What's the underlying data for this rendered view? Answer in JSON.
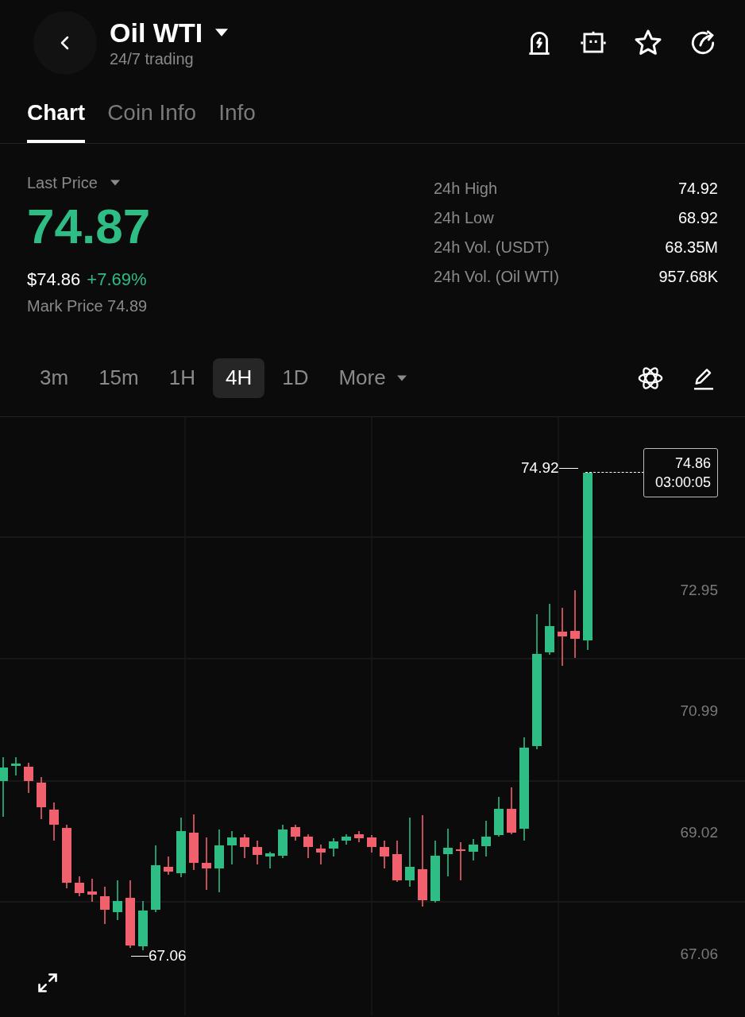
{
  "header": {
    "title": "Oil WTI",
    "subtitle": "24/7 trading"
  },
  "tabs": [
    {
      "label": "Chart",
      "selected": true
    },
    {
      "label": "Coin Info",
      "selected": false
    },
    {
      "label": "Info",
      "selected": false
    }
  ],
  "price": {
    "label": "Last Price",
    "value": "74.87",
    "usd": "$74.86",
    "change": "+7.69%",
    "mark_price": "Mark Price 74.89"
  },
  "stats": [
    {
      "label": "24h High",
      "value": "74.92"
    },
    {
      "label": "24h Low",
      "value": "68.92"
    },
    {
      "label": "24h Vol. (USDT)",
      "value": "68.35M"
    },
    {
      "label": "24h Vol. (Oil WTI)",
      "value": "957.68K"
    }
  ],
  "intervals": [
    {
      "label": "3m",
      "selected": false
    },
    {
      "label": "15m",
      "selected": false
    },
    {
      "label": "1H",
      "selected": false
    },
    {
      "label": "4H",
      "selected": true
    },
    {
      "label": "1D",
      "selected": false
    },
    {
      "label": "More",
      "selected": false,
      "dropdown": true
    }
  ],
  "chart": {
    "y_labels": [
      "72.95",
      "70.99",
      "69.02",
      "67.06"
    ],
    "high_label": "74.92",
    "low_label": "67.06",
    "current_price": "74.86",
    "countdown": "03:00:05"
  }
}
